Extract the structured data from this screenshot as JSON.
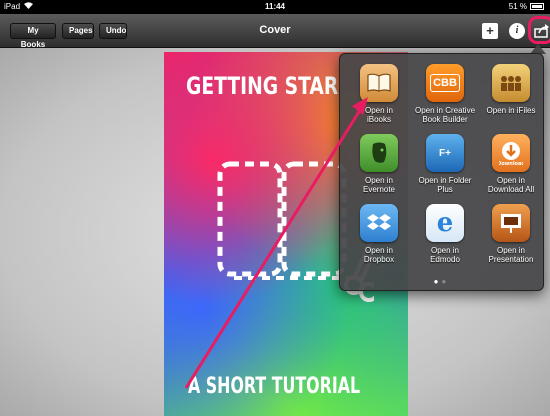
{
  "status": {
    "device": "iPad",
    "time": "11:44",
    "battery": "51 %"
  },
  "navbar": {
    "my_books": "My Books",
    "pages": "Pages",
    "undo": "Undo",
    "title": "Cover",
    "plus": "+",
    "info": "i"
  },
  "cover": {
    "title": "GETTING STAR",
    "subtitle": "A SHORT TUTORIAL"
  },
  "share_menu": {
    "items": [
      {
        "label_1": "Open in",
        "label_2": "iBooks",
        "icon": "ibooks-icon"
      },
      {
        "label_1": "Open in Creative",
        "label_2": "Book Builder",
        "icon": "cbb-icon",
        "glyph": "CBB"
      },
      {
        "label_1": "Open in iFiles",
        "label_2": "",
        "icon": "ifiles-icon"
      },
      {
        "label_1": "Open in",
        "label_2": "Evernote",
        "icon": "evernote-icon"
      },
      {
        "label_1": "Open in Folder",
        "label_2": "Plus",
        "icon": "folder-plus-icon",
        "glyph": "F+"
      },
      {
        "label_1": "Open in",
        "label_2": "Download All",
        "icon": "download-icon",
        "glyph": "Download"
      },
      {
        "label_1": "Open in",
        "label_2": "Dropbox",
        "icon": "dropbox-icon"
      },
      {
        "label_1": "Open in",
        "label_2": "Edmodo",
        "icon": "edmodo-icon",
        "glyph": "e"
      },
      {
        "label_1": "Open in",
        "label_2": "Presentation",
        "icon": "presentation-icon"
      }
    ]
  },
  "colors": {
    "highlight": "#e81d61",
    "arrow": "#e81d61"
  }
}
